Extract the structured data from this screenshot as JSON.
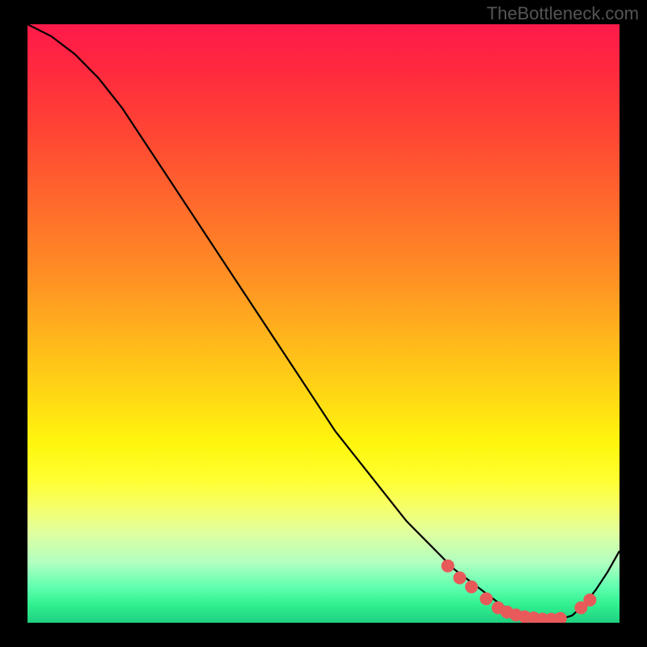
{
  "watermark": "TheBottleneck.com",
  "chart_data": {
    "type": "line",
    "title": "",
    "xlabel": "",
    "ylabel": "",
    "xlim": [
      0,
      100
    ],
    "ylim": [
      0,
      100
    ],
    "series": [
      {
        "name": "curve",
        "x": [
          0,
          4,
          8,
          12,
          16,
          20,
          24,
          28,
          32,
          36,
          40,
          44,
          48,
          52,
          56,
          60,
          64,
          68,
          72,
          76,
          80,
          82,
          84,
          86,
          88,
          90,
          92,
          94,
          96,
          98,
          100
        ],
        "y": [
          100,
          98,
          95,
          91,
          86,
          80,
          74,
          68,
          62,
          56,
          50,
          44,
          38,
          32,
          27,
          22,
          17,
          13,
          9,
          6,
          3,
          1.8,
          1.0,
          0.6,
          0.5,
          0.6,
          1.2,
          3.0,
          5.5,
          8.5,
          12
        ]
      }
    ],
    "points": [
      {
        "x": 71.0,
        "y": 9.5
      },
      {
        "x": 73.0,
        "y": 7.5
      },
      {
        "x": 75.0,
        "y": 6.0
      },
      {
        "x": 77.5,
        "y": 4.0
      },
      {
        "x": 79.5,
        "y": 2.5
      },
      {
        "x": 81.0,
        "y": 1.8
      },
      {
        "x": 82.5,
        "y": 1.3
      },
      {
        "x": 84.0,
        "y": 1.0
      },
      {
        "x": 85.5,
        "y": 0.8
      },
      {
        "x": 87.0,
        "y": 0.6
      },
      {
        "x": 88.5,
        "y": 0.6
      },
      {
        "x": 90.0,
        "y": 0.7
      },
      {
        "x": 93.5,
        "y": 2.5
      },
      {
        "x": 95.0,
        "y": 3.8
      }
    ],
    "colors": {
      "top": "#ff1a4a",
      "mid": "#ffe030",
      "bottom": "#20d080",
      "curve": "#000000",
      "points": "#e85a5a"
    }
  }
}
